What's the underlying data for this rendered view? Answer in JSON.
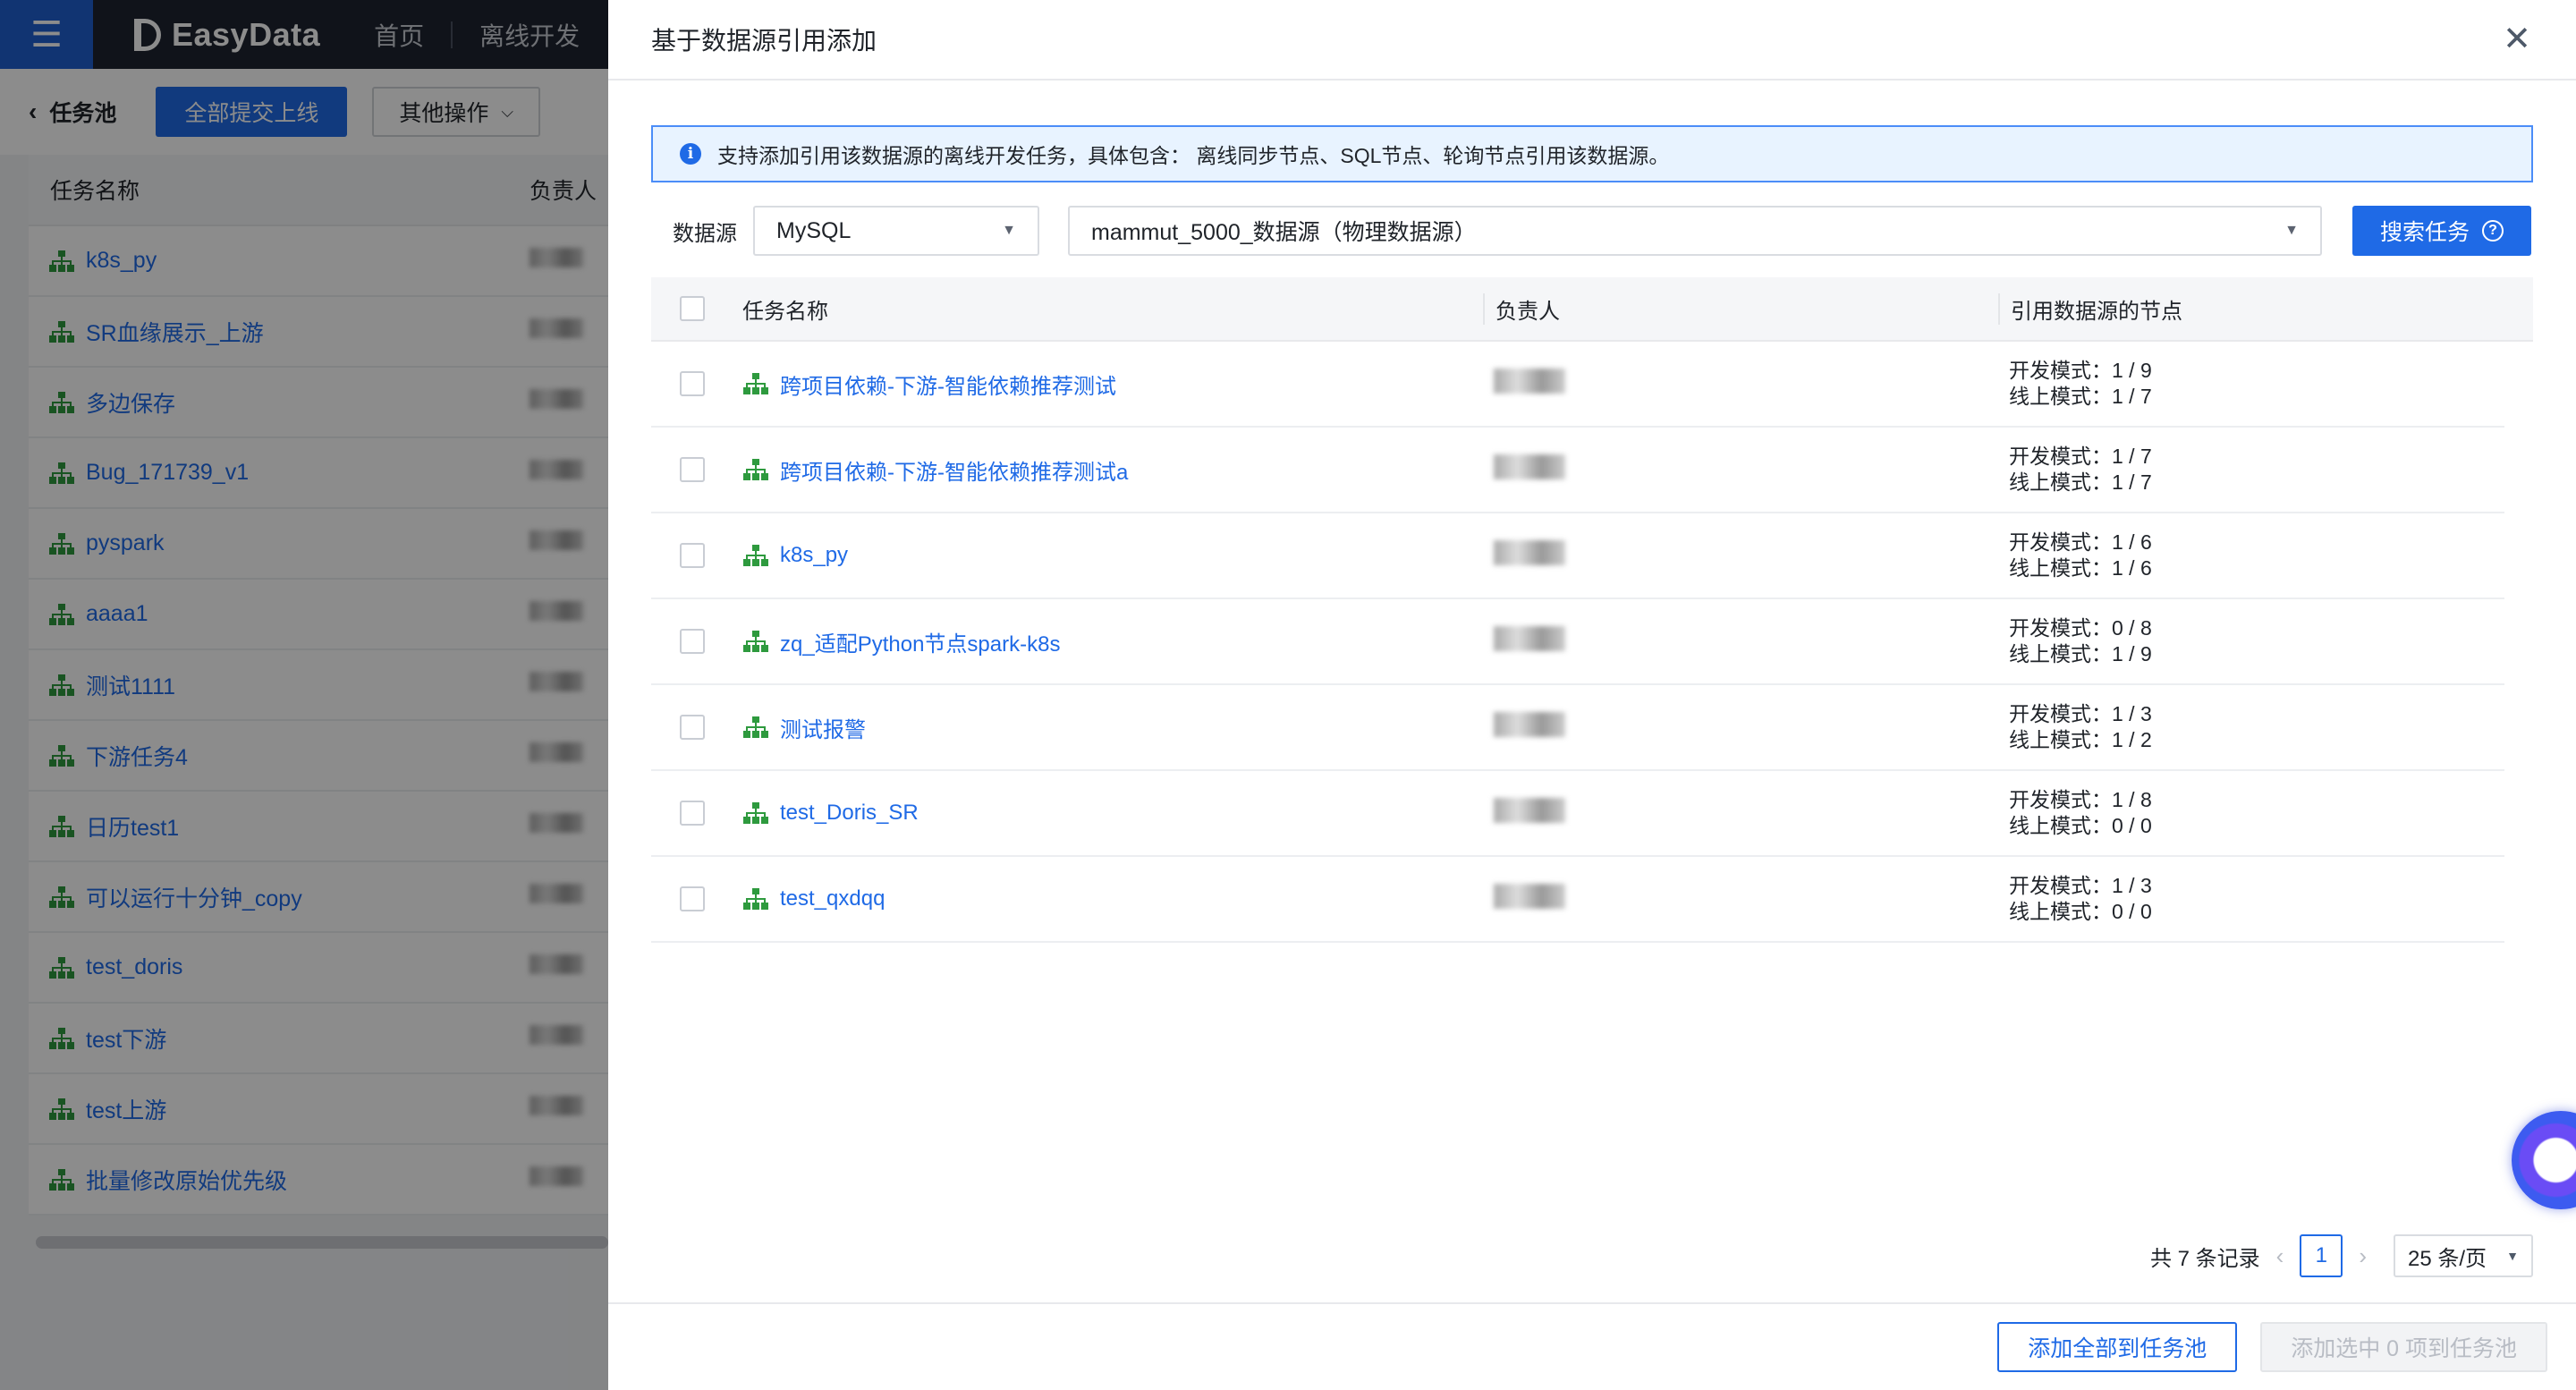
{
  "app": {
    "logo_text": "EasyData",
    "nav": [
      "首页",
      "离线开发"
    ]
  },
  "pool": {
    "back_label": "任务池",
    "submit_all_label": "全部提交上线",
    "more_ops_label": "其他操作",
    "headers": {
      "name": "任务名称",
      "owner": "负责人"
    },
    "rows": [
      "k8s_py",
      "SR血缘展示_上游",
      "多边保存",
      "Bug_171739_v1",
      "pyspark",
      "aaaa1",
      "测试1111",
      "下游任务4",
      "日历test1",
      "可以运行十分钟_copy",
      "test_doris",
      "test下游",
      "test上游",
      "批量修改原始优先级"
    ]
  },
  "drawer": {
    "title": "基于数据源引用添加",
    "info": "支持添加引用该数据源的离线开发任务，具体包含： 离线同步节点、SQL节点、轮询节点引用该数据源。",
    "filter": {
      "label": "数据源",
      "db_type": "MySQL",
      "source": "mammut_5000_数据源（物理数据源）",
      "search_label": "搜索任务"
    },
    "table": {
      "headers": {
        "name": "任务名称",
        "owner": "负责人",
        "ref": "引用数据源的节点"
      },
      "rows": [
        {
          "name": "跨项目依赖-下游-智能依赖推荐测试",
          "dev": "开发模式：1 / 9",
          "online": "线上模式：1 / 7"
        },
        {
          "name": "跨项目依赖-下游-智能依赖推荐测试a",
          "dev": "开发模式：1 / 7",
          "online": "线上模式：1 / 7"
        },
        {
          "name": "k8s_py",
          "dev": "开发模式：1 / 6",
          "online": "线上模式：1 / 6"
        },
        {
          "name": "zq_适配Python节点spark-k8s",
          "dev": "开发模式：0 / 8",
          "online": "线上模式：1 / 9"
        },
        {
          "name": "测试报警",
          "dev": "开发模式：1 / 3",
          "online": "线上模式：1 / 2"
        },
        {
          "name": "test_Doris_SR",
          "dev": "开发模式：1 / 8",
          "online": "线上模式：0 / 0"
        },
        {
          "name": "test_qxdqq",
          "dev": "开发模式：1 / 3",
          "online": "线上模式：0 / 0"
        }
      ]
    },
    "pagination": {
      "total": "共 7 条记录",
      "current_page": "1",
      "page_size": "25 条/页"
    },
    "footer": {
      "add_all_label": "添加全部到任务池",
      "add_selected_label": "添加选中 0 项到任务池"
    }
  },
  "colors": {
    "primary": "#1f6ae6",
    "topbar": "#1e2430",
    "tree_icon": "#2e9a3e"
  }
}
